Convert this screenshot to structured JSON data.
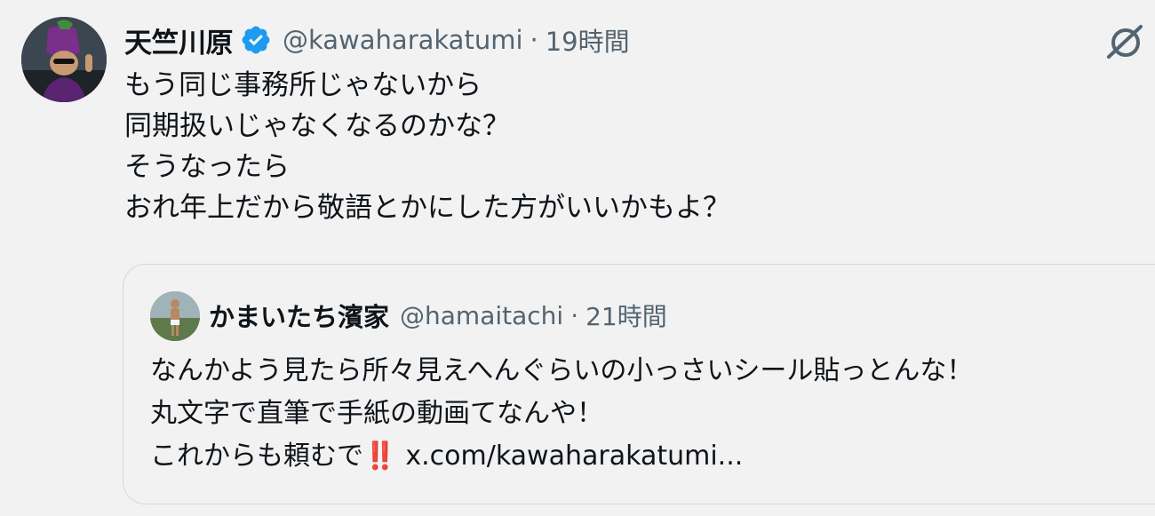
{
  "tweet": {
    "author_name": "天竺川原",
    "handle": "@kawaharakatumi",
    "separator": "·",
    "time": "19時間",
    "lines": [
      "もう同じ事務所じゃないから",
      "同期扱いじゃなくなるのかな？",
      "そうなったら",
      "おれ年上だから敬語とかにした方がいいかもよ？"
    ]
  },
  "quote": {
    "author_name": "かまいたち濱家",
    "handle": "@hamaitachi",
    "separator": "·",
    "time": "21時間",
    "lines": [
      "なんかよう見たら所々見えへんぐらいの小っさいシール貼っとんな！",
      "丸文字で直筆で手紙の動画てなんや！"
    ],
    "last_line_text": "これからも頼むで",
    "last_line_emoji": "‼️",
    "link": "x.com/kawaharakatumi..."
  },
  "icons": {
    "verified": "verified-badge-icon",
    "menu": "grok-slash-icon"
  },
  "colors": {
    "background": "#f2f2f2",
    "text": "#0f1419",
    "secondary_text": "#536471",
    "verified_blue": "#1d9bf0",
    "border": "#cfd9de",
    "emoji_red": "#d0112b"
  }
}
